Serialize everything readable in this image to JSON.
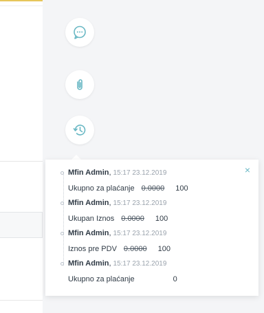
{
  "side_panel": {
    "buttons": [
      {
        "id": "comments",
        "icon": "chat-bubble-icon"
      },
      {
        "id": "attachments",
        "icon": "paperclip-icon"
      },
      {
        "id": "history",
        "icon": "history-icon"
      }
    ],
    "accent_color": "#69b8c4"
  },
  "history": {
    "close_label": "×",
    "entries": [
      {
        "user": "Mfin Admin",
        "time": "15:17 23.12.2019",
        "field": "Ukupno za plaćanje",
        "old_value": "0.0000",
        "new_value": "100"
      },
      {
        "user": "Mfin Admin",
        "time": "15:17 23.12.2019",
        "field": "Ukupan Iznos",
        "old_value": "0.0000",
        "new_value": "100"
      },
      {
        "user": "Mfin Admin",
        "time": "15:17 23.12.2019",
        "field": "Iznos pre PDV",
        "old_value": "0.0000",
        "new_value": "100"
      },
      {
        "user": "Mfin Admin",
        "time": "15:17 23.12.2019",
        "field": "Ukupno za plaćanje",
        "old_value": "",
        "new_value": "0"
      }
    ]
  }
}
